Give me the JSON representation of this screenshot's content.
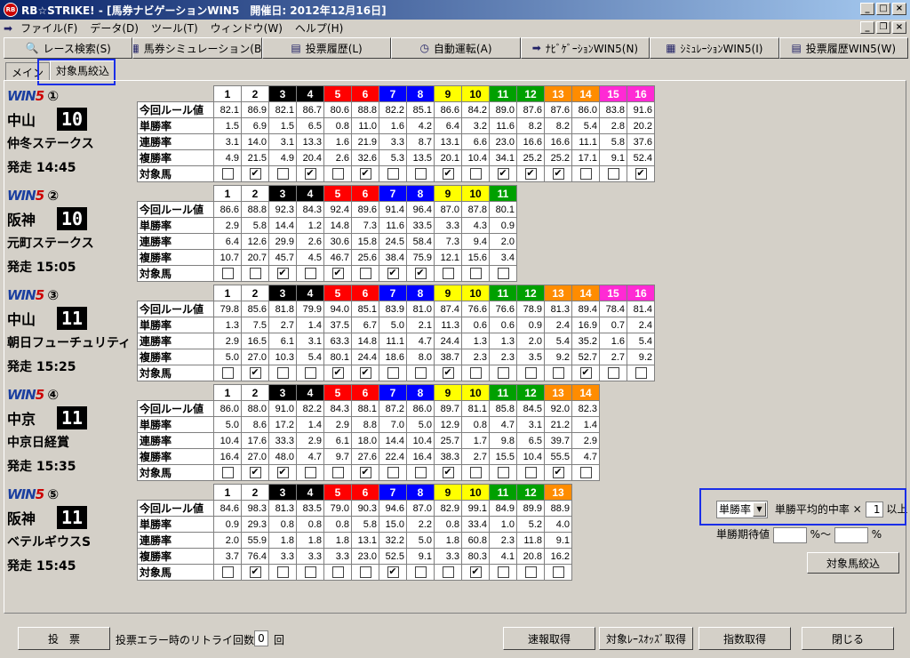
{
  "window": {
    "title": "RB☆STRIKE! - [馬券ナビゲーションWIN5　開催日: 2012年12月16日]",
    "app_icon": "RB"
  },
  "menu": [
    "ファイル(F)",
    "データ(D)",
    "ツール(T)",
    "ウィンドウ(W)",
    "ヘルプ(H)"
  ],
  "toolbar": [
    {
      "label": "レース検索(S)",
      "icon": "search-icon",
      "glyph": "🔍"
    },
    {
      "label": "馬券シミュレーション(B)",
      "icon": "grid-icon",
      "glyph": "▦"
    },
    {
      "label": "投票履歴(L)",
      "icon": "document-icon",
      "glyph": "▤"
    },
    {
      "label": "自動運転(A)",
      "icon": "clock-icon",
      "glyph": "◷"
    },
    {
      "label": "ﾅﾋﾞｹﾞｰｼｮﾝWIN5(N)",
      "icon": "arrow-icon",
      "glyph": "➡"
    },
    {
      "label": "ｼﾐｭﾚｰｼｮﾝWIN5(I)",
      "icon": "grid-icon",
      "glyph": "▦"
    },
    {
      "label": "投票履歴WIN5(W)",
      "icon": "document-icon",
      "glyph": "▤"
    }
  ],
  "tabs": [
    "メイン",
    "対象馬絞込"
  ],
  "row_labels": [
    "今回ルール値",
    "単勝率",
    "連勝率",
    "複勝率",
    "対象馬"
  ],
  "horse_colors": [
    "#ffffff",
    "#ffffff",
    "#000000",
    "#000000",
    "#ff0000",
    "#ff0000",
    "#0000ff",
    "#0000ff",
    "#ffff00",
    "#ffff00",
    "#00a000",
    "#00a000",
    "#ff8c00",
    "#ff8c00",
    "#ff2ad4",
    "#ff2ad4",
    "#ff2ad4",
    "#ff2ad4"
  ],
  "races": [
    {
      "leg": "①",
      "venue": "中山",
      "race_no": "10",
      "name": "仲冬ステークス",
      "start": "発走 14:45",
      "rule": [
        "82.1",
        "86.9",
        "82.1",
        "86.7",
        "80.6",
        "88.8",
        "82.2",
        "85.1",
        "86.6",
        "84.2",
        "89.0",
        "87.6",
        "87.6",
        "86.0",
        "83.8",
        "91.6"
      ],
      "win": [
        "1.5",
        "6.9",
        "1.5",
        "6.5",
        "0.8",
        "11.0",
        "1.6",
        "4.2",
        "6.4",
        "3.2",
        "11.6",
        "8.2",
        "8.2",
        "5.4",
        "2.8",
        "20.2"
      ],
      "quinella": [
        "3.1",
        "14.0",
        "3.1",
        "13.3",
        "1.6",
        "21.9",
        "3.3",
        "8.7",
        "13.1",
        "6.6",
        "23.0",
        "16.6",
        "16.6",
        "11.1",
        "5.8",
        "37.6"
      ],
      "place": [
        "4.9",
        "21.5",
        "4.9",
        "20.4",
        "2.6",
        "32.6",
        "5.3",
        "13.5",
        "20.1",
        "10.4",
        "34.1",
        "25.2",
        "25.2",
        "17.1",
        "9.1",
        "52.4"
      ],
      "target": [
        false,
        true,
        false,
        true,
        false,
        true,
        false,
        false,
        true,
        false,
        true,
        true,
        true,
        false,
        false,
        true
      ]
    },
    {
      "leg": "②",
      "venue": "阪神",
      "race_no": "10",
      "name": "元町ステークス",
      "start": "発走 15:05",
      "rule": [
        "86.6",
        "88.8",
        "92.3",
        "84.3",
        "92.4",
        "89.6",
        "91.4",
        "96.4",
        "87.0",
        "87.8",
        "80.1"
      ],
      "win": [
        "2.9",
        "5.8",
        "14.4",
        "1.2",
        "14.8",
        "7.3",
        "11.6",
        "33.5",
        "3.3",
        "4.3",
        "0.9"
      ],
      "quinella": [
        "6.4",
        "12.6",
        "29.9",
        "2.6",
        "30.6",
        "15.8",
        "24.5",
        "58.4",
        "7.3",
        "9.4",
        "2.0"
      ],
      "place": [
        "10.7",
        "20.7",
        "45.7",
        "4.5",
        "46.7",
        "25.6",
        "38.4",
        "75.9",
        "12.1",
        "15.6",
        "3.4"
      ],
      "target": [
        false,
        false,
        true,
        false,
        true,
        false,
        true,
        true,
        false,
        false,
        false
      ]
    },
    {
      "leg": "③",
      "venue": "中山",
      "race_no": "11",
      "name": "朝日フューチュリティ",
      "start": "発走 15:25",
      "rule": [
        "79.8",
        "85.6",
        "81.8",
        "79.9",
        "94.0",
        "85.1",
        "83.9",
        "81.0",
        "87.4",
        "76.6",
        "76.6",
        "78.9",
        "81.3",
        "89.4",
        "78.4",
        "81.4"
      ],
      "win": [
        "1.3",
        "7.5",
        "2.7",
        "1.4",
        "37.5",
        "6.7",
        "5.0",
        "2.1",
        "11.3",
        "0.6",
        "0.6",
        "0.9",
        "2.4",
        "16.9",
        "0.7",
        "2.4"
      ],
      "quinella": [
        "2.9",
        "16.5",
        "6.1",
        "3.1",
        "63.3",
        "14.8",
        "11.1",
        "4.7",
        "24.4",
        "1.3",
        "1.3",
        "2.0",
        "5.4",
        "35.2",
        "1.6",
        "5.4"
      ],
      "place": [
        "5.0",
        "27.0",
        "10.3",
        "5.4",
        "80.1",
        "24.4",
        "18.6",
        "8.0",
        "38.7",
        "2.3",
        "2.3",
        "3.5",
        "9.2",
        "52.7",
        "2.7",
        "9.2"
      ],
      "target": [
        false,
        true,
        false,
        false,
        true,
        true,
        false,
        false,
        true,
        false,
        false,
        false,
        false,
        true,
        false,
        false
      ]
    },
    {
      "leg": "④",
      "venue": "中京",
      "race_no": "11",
      "name": "中京日経賞",
      "start": "発走 15:35",
      "rule": [
        "86.0",
        "88.0",
        "91.0",
        "82.2",
        "84.3",
        "88.1",
        "87.2",
        "86.0",
        "89.7",
        "81.1",
        "85.8",
        "84.5",
        "92.0",
        "82.3"
      ],
      "win": [
        "5.0",
        "8.6",
        "17.2",
        "1.4",
        "2.9",
        "8.8",
        "7.0",
        "5.0",
        "12.9",
        "0.8",
        "4.7",
        "3.1",
        "21.2",
        "1.4"
      ],
      "quinella": [
        "10.4",
        "17.6",
        "33.3",
        "2.9",
        "6.1",
        "18.0",
        "14.4",
        "10.4",
        "25.7",
        "1.7",
        "9.8",
        "6.5",
        "39.7",
        "2.9"
      ],
      "place": [
        "16.4",
        "27.0",
        "48.0",
        "4.7",
        "9.7",
        "27.6",
        "22.4",
        "16.4",
        "38.3",
        "2.7",
        "15.5",
        "10.4",
        "55.5",
        "4.7"
      ],
      "target": [
        false,
        true,
        true,
        false,
        false,
        true,
        false,
        false,
        true,
        false,
        false,
        false,
        true,
        false
      ]
    },
    {
      "leg": "⑤",
      "venue": "阪神",
      "race_no": "11",
      "name": "ベテルギウスS",
      "start": "発走 15:45",
      "rule": [
        "84.6",
        "98.3",
        "81.3",
        "83.5",
        "79.0",
        "90.3",
        "94.6",
        "87.0",
        "82.9",
        "99.1",
        "84.9",
        "89.9",
        "88.9"
      ],
      "win": [
        "0.9",
        "29.3",
        "0.8",
        "0.8",
        "0.8",
        "5.8",
        "15.0",
        "2.2",
        "0.8",
        "33.4",
        "1.0",
        "5.2",
        "4.0"
      ],
      "quinella": [
        "2.0",
        "55.9",
        "1.8",
        "1.8",
        "1.8",
        "13.1",
        "32.2",
        "5.0",
        "1.8",
        "60.8",
        "2.3",
        "11.8",
        "9.1"
      ],
      "place": [
        "3.7",
        "76.4",
        "3.3",
        "3.3",
        "3.3",
        "23.0",
        "52.5",
        "9.1",
        "3.3",
        "80.3",
        "4.1",
        "20.8",
        "16.2"
      ],
      "target": [
        false,
        true,
        false,
        false,
        false,
        false,
        true,
        false,
        false,
        true,
        false,
        false,
        false
      ]
    }
  ],
  "filter": {
    "criterion": "単勝率",
    "avg_label": "単勝平均的中率",
    "times": "×",
    "multiplier": "1",
    "above": "以上",
    "expect_label": "単勝期待値",
    "pct1": "%〜",
    "pct2": "%",
    "button": "対象馬絞込"
  },
  "bottom": {
    "vote": "投　票",
    "retry_label": "投票エラー時のリトライ回数:",
    "retry_value": "0",
    "retry_unit": "回",
    "fetch_odds": "速報取得",
    "target_odds": "対象ﾚｰｽｵｯｽﾞ取得",
    "index_fetch": "指数取得",
    "close": "閉じる"
  }
}
